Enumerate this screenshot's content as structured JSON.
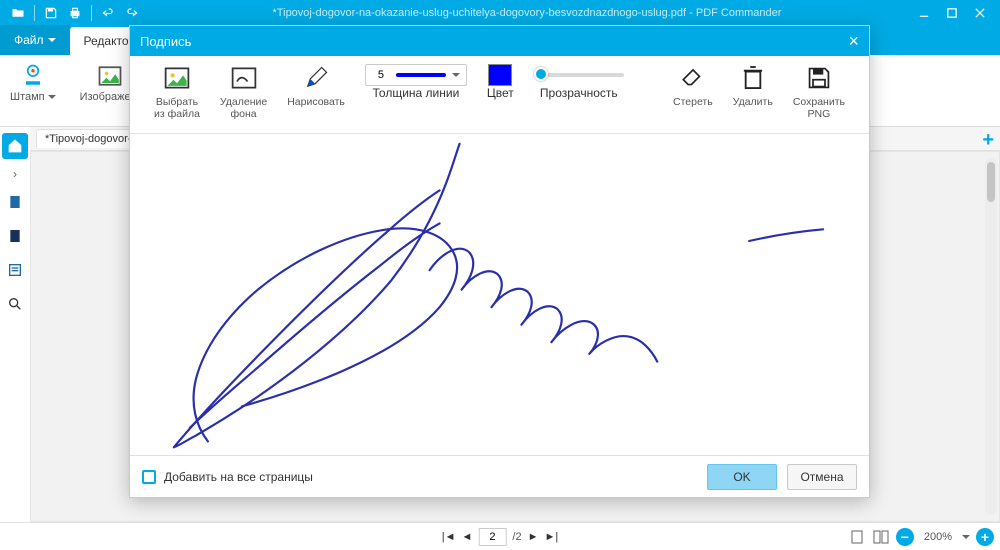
{
  "title_text": "*Tipovoj-dogovor-na-okazanie-uslug-uchitelya-dogovory-besvozdnazdnogo-uslug.pdf - PDF Commander",
  "tabs": {
    "file": "Файл",
    "editor": "Редактор"
  },
  "ribbon": {
    "stamp": "Штамп",
    "image": "Изображе..."
  },
  "doc_tab": "*Tipovoj-dogovor-na-ok...",
  "pager": {
    "current": "2",
    "of": "/2"
  },
  "zoom_value": "200%",
  "modal": {
    "title": "Подпись",
    "tools": {
      "from_file": "Выбрать\nиз файла",
      "remove_bg": "Удаление\nфона",
      "draw": "Нарисовать",
      "line_width_label": "Толщина линии",
      "line_width_value": "5",
      "color_label": "Цвет",
      "color_value": "#0000ff",
      "transparency_label": "Прозрачность",
      "erase": "Стереть",
      "delete": "Удалить",
      "save_png": "Сохранить\nPNG"
    },
    "add_all_pages": "Добавить на все страницы",
    "ok": "OK",
    "cancel": "Отмена"
  }
}
